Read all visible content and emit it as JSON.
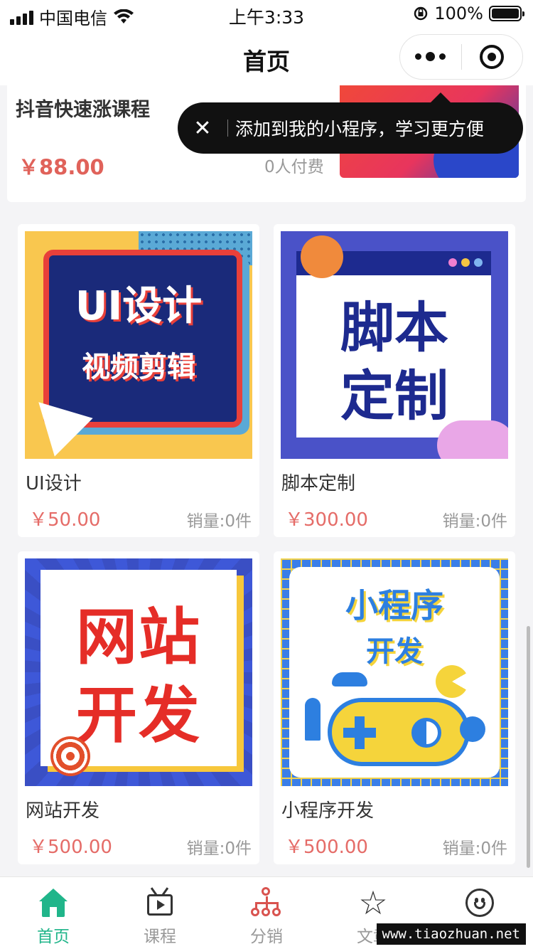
{
  "status_bar": {
    "carrier": "中国电信",
    "time": "上午3:33",
    "battery": "100%"
  },
  "nav": {
    "title": "首页",
    "icons": [
      "more-icon",
      "close-miniprogram-icon"
    ]
  },
  "tooltip": {
    "text": "添加到我的小程序，学习更方便",
    "close_icon": "close-icon"
  },
  "featured_course": {
    "title": "抖音快速涨课程",
    "price": "￥88.00",
    "paid": "0人付费"
  },
  "products": [
    {
      "name": "UI设计",
      "price": "￥50.00",
      "sales": "销量:0件",
      "thumb_line1": "UI设计",
      "thumb_line2": "视频剪辑"
    },
    {
      "name": "脚本定制",
      "price": "￥300.00",
      "sales": "销量:0件",
      "thumb_line1": "脚本",
      "thumb_line2": "定制"
    },
    {
      "name": "网站开发",
      "price": "￥500.00",
      "sales": "销量:0件",
      "thumb_line1": "网站",
      "thumb_line2": "开发"
    },
    {
      "name": "小程序开发",
      "price": "￥500.00",
      "sales": "销量:0件",
      "thumb_line1": "小程序",
      "thumb_line2": "开发"
    }
  ],
  "tabs": [
    {
      "label": "首页",
      "icon": "home-icon",
      "active": true
    },
    {
      "label": "课程",
      "icon": "video-course-icon",
      "active": false
    },
    {
      "label": "分销",
      "icon": "distribution-icon",
      "active": false
    },
    {
      "label": "文章",
      "icon": "star-icon",
      "active": false
    },
    {
      "label": "",
      "icon": "smile-icon",
      "active": false
    }
  ],
  "watermark": "www.tiaozhuan.net",
  "colors": {
    "accent": "#20b58a",
    "price": "#e56c68",
    "distribution_icon": "#d9534f",
    "tooltip_bg": "#111111"
  }
}
